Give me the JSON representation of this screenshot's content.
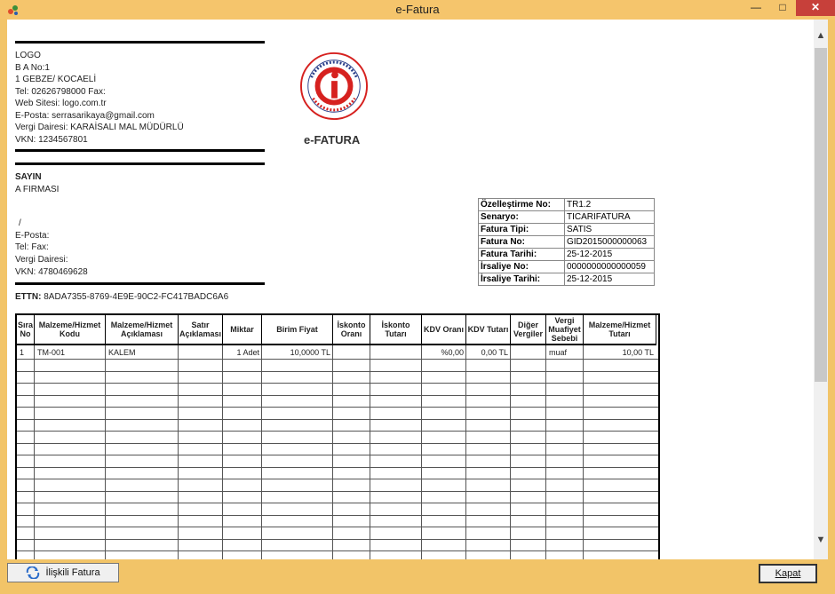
{
  "window": {
    "title": "e-Fatura",
    "close_glyph": "✕",
    "min_glyph": "—",
    "max_glyph": "□"
  },
  "seller": {
    "lines": [
      "LOGO",
      "B A  No:1",
      "1 GEBZE/ KOCAELİ",
      "Tel: 02626798000 Fax:",
      "Web Sitesi: logo.com.tr",
      "E-Posta: serrasarikaya@gmail.com",
      "Vergi Dairesi: KARAİSALI MAL MÜDÜRLÜ",
      "VKN: 1234567801"
    ]
  },
  "logo": {
    "caption": "e-FATURA",
    "ring_text": "T.C. MALİYE BAKANLIĞI · Gelir İdaresi Başkanlığı",
    "color": "#d6211f"
  },
  "buyer": {
    "heading": "SAYIN",
    "name": "A FIRMASI",
    "slash": "/",
    "email": "E-Posta:",
    "tel": "Tel: Fax:",
    "tax_office": "Vergi Dairesi:",
    "vkn": "VKN: 4780469628"
  },
  "ettn": {
    "label": "ETTN:",
    "value": "8ADA7355-8769-4E9E-90C2-FC417BADC6A6"
  },
  "info": [
    {
      "k": "Özelleştirme No:",
      "v": "TR1.2"
    },
    {
      "k": "Senaryo:",
      "v": "TICARIFATURA"
    },
    {
      "k": "Fatura Tipi:",
      "v": "SATIS"
    },
    {
      "k": "Fatura No:",
      "v": "GID2015000000063"
    },
    {
      "k": "Fatura Tarihi:",
      "v": "25-12-2015"
    },
    {
      "k": "İrsaliye No:",
      "v": "0000000000000059"
    },
    {
      "k": "İrsaliye Tarihi:",
      "v": "25-12-2015"
    }
  ],
  "grid": {
    "headers": [
      "Sıra No",
      "Malzeme/Hizmet Kodu",
      "Malzeme/Hizmet Açıklaması",
      "Satır Açıklaması",
      "Miktar",
      "Birim Fiyat",
      "İskonto Oranı",
      "İskonto Tutarı",
      "KDV Oranı",
      "KDV Tutarı",
      "Diğer Vergiler",
      "Vergi Muafiyet Sebebi",
      "Malzeme/Hizmet Tutarı"
    ],
    "rows": [
      [
        "1",
        "TM-001",
        "KALEM",
        "",
        "1 Adet",
        "10,0000 TL",
        "",
        "",
        "%0,00",
        "0,00 TL",
        "",
        "muaf",
        "10,00 TL"
      ]
    ]
  },
  "buttons": {
    "related_invoice": "İlişkili Fatura",
    "close": "Kapat"
  }
}
